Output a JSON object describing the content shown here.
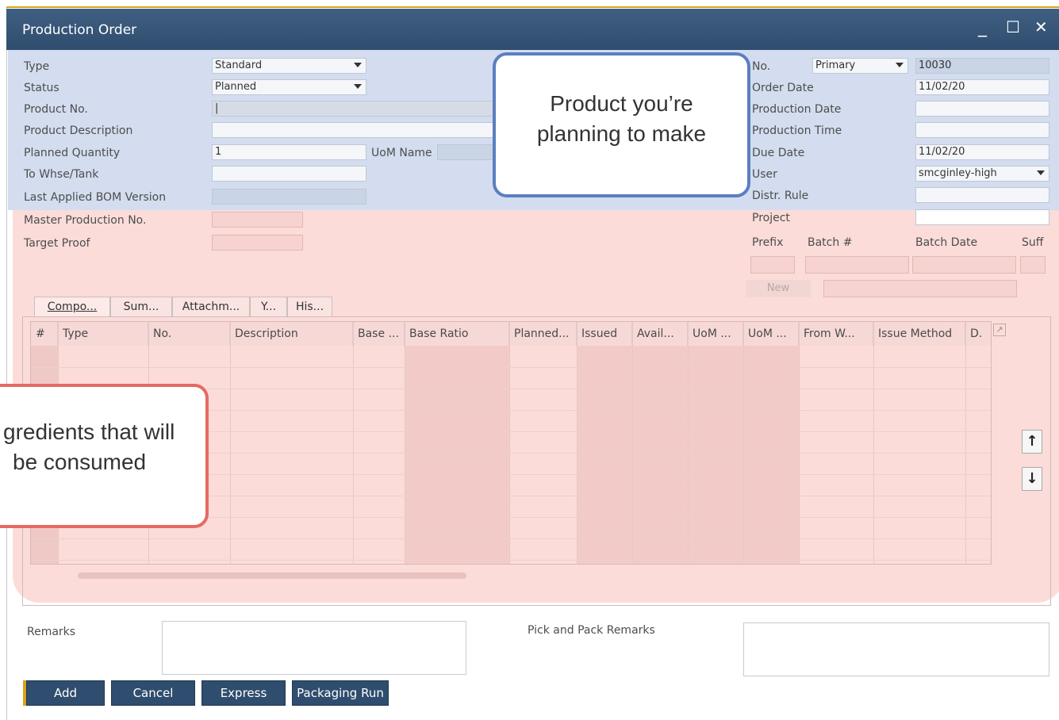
{
  "window": {
    "title": "Production Order",
    "minimize": "_",
    "maximize": "☐",
    "close": "✕"
  },
  "left_fields": [
    {
      "label": "Type",
      "value": "Standard",
      "dropdown": true
    },
    {
      "label": "Status",
      "value": "Planned",
      "dropdown": true
    },
    {
      "label": "Product No.",
      "value": "|"
    },
    {
      "label": "Product Description",
      "value": ""
    },
    {
      "label": "Planned Quantity",
      "value": "1"
    },
    {
      "label": "To Whse/Tank",
      "value": ""
    },
    {
      "label": "Last Applied BOM Version",
      "value": ""
    },
    {
      "label": "Master Production No.",
      "value": ""
    },
    {
      "label": "Target Proof",
      "value": ""
    }
  ],
  "uom_name_label": "UoM Name",
  "right_fields": {
    "no_label": "No.",
    "series": "Primary",
    "no_value": "10030",
    "order_date_label": "Order Date",
    "order_date": "11/02/20",
    "production_date_label": "Production Date",
    "production_date": "",
    "production_time_label": "Production Time",
    "production_time": "",
    "due_date_label": "Due Date",
    "due_date": "11/02/20",
    "user_label": "User",
    "user": "smcginley-high",
    "distr_rule_label": "Distr. Rule",
    "distr_rule": "",
    "project_label": "Project",
    "project": ""
  },
  "batch": {
    "prefix_label": "Prefix",
    "batch_label": "Batch #",
    "batch_date_label": "Batch Date",
    "suffix_label": "Suff",
    "new_button": "New"
  },
  "tabs": [
    "Compo...",
    "Sum...",
    "Attachm...",
    "Y...",
    "His..."
  ],
  "grid_columns": [
    "#",
    "Type",
    "No.",
    "Description",
    "Base ...",
    "Base Ratio",
    "Planned...",
    "Issued",
    "Avail...",
    "UoM ...",
    "UoM ...",
    "From W...",
    "Issue Method",
    "D."
  ],
  "callouts": {
    "product": "Product you’re planning to make",
    "ingredients_line1": "gredients that will",
    "ingredients_line2": "be consumed"
  },
  "remarks_label": "Remarks",
  "pick_pack_label": "Pick and Pack Remarks",
  "buttons": {
    "add": "Add",
    "cancel": "Cancel",
    "express": "Express",
    "packaging_run": "Packaging Run"
  },
  "colors": {
    "title_bar": "#2f4d6e",
    "header_highlight": "#d3ddef",
    "details_highlight": "#fbdcd9",
    "accent": "#d8a21a",
    "product_callout_border": "#5b7fc0",
    "ingredients_callout_border": "#e46a62"
  }
}
